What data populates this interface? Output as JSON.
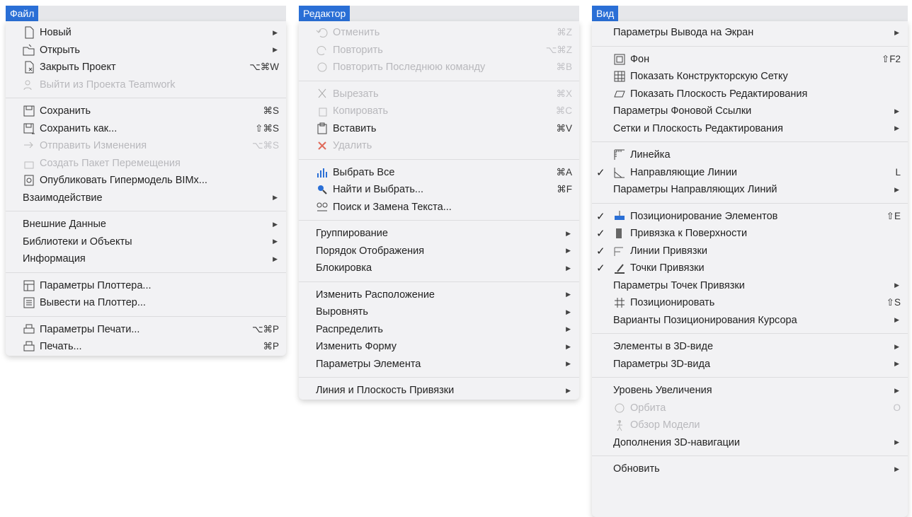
{
  "menus": [
    {
      "title": "Файл",
      "items": [
        {
          "label": "Новый",
          "icon": "new-file-icon",
          "submenu": true
        },
        {
          "label": "Открыть",
          "icon": "open-folder-icon",
          "submenu": true
        },
        {
          "label": "Закрыть Проект",
          "icon": "close-project-icon",
          "shortcut": "⌥⌘W"
        },
        {
          "label": "Выйти из Проекта Teamwork",
          "icon": "teamwork-icon",
          "disabled": true
        },
        {
          "sep": true
        },
        {
          "label": "Сохранить",
          "icon": "save-icon",
          "shortcut": "⌘S"
        },
        {
          "label": "Сохранить как...",
          "icon": "save-as-icon",
          "shortcut": "⇧⌘S"
        },
        {
          "label": "Отправить Изменения",
          "icon": "send-icon",
          "shortcut": "⌥⌘S",
          "disabled": true
        },
        {
          "label": "Создать Пакет Перемещения",
          "icon": "package-icon",
          "disabled": true
        },
        {
          "label": "Опубликовать Гипермодель BIMx...",
          "icon": "publish-icon"
        },
        {
          "label": "Взаимодействие",
          "submenu": true
        },
        {
          "sep": true
        },
        {
          "label": "Внешние Данные",
          "submenu": true
        },
        {
          "label": "Библиотеки и Объекты",
          "submenu": true
        },
        {
          "label": "Информация",
          "submenu": true
        },
        {
          "sep": true
        },
        {
          "label": "Параметры Плоттера...",
          "icon": "plotter-settings-icon"
        },
        {
          "label": "Вывести на Плоттер...",
          "icon": "plotter-icon"
        },
        {
          "sep": true
        },
        {
          "label": "Параметры Печати...",
          "icon": "print-settings-icon",
          "shortcut": "⌥⌘P"
        },
        {
          "label": "Печать...",
          "icon": "print-icon",
          "shortcut": "⌘P"
        }
      ]
    },
    {
      "title": "Редактор",
      "items": [
        {
          "label": "Отменить",
          "icon": "undo-icon",
          "shortcut": "⌘Z",
          "disabled": true
        },
        {
          "label": "Повторить",
          "icon": "redo-icon",
          "shortcut": "⌥⌘Z",
          "disabled": true
        },
        {
          "label": "Повторить Последнюю команду",
          "icon": "repeat-icon",
          "shortcut": "⌘B",
          "disabled": true
        },
        {
          "sep": true
        },
        {
          "label": "Вырезать",
          "icon": "cut-icon",
          "shortcut": "⌘X",
          "disabled": true
        },
        {
          "label": "Копировать",
          "icon": "copy-icon",
          "shortcut": "⌘C",
          "disabled": true
        },
        {
          "label": "Вставить",
          "icon": "paste-icon",
          "shortcut": "⌘V"
        },
        {
          "label": "Удалить",
          "icon": "delete-icon",
          "disabled": true
        },
        {
          "sep": true
        },
        {
          "label": "Выбрать Все",
          "icon": "select-all-icon",
          "shortcut": "⌘A"
        },
        {
          "label": "Найти и Выбрать...",
          "icon": "find-select-icon",
          "shortcut": "⌘F"
        },
        {
          "label": "Поиск и Замена Текста...",
          "icon": "find-replace-icon"
        },
        {
          "sep": true
        },
        {
          "label": "Группирование",
          "submenu": true
        },
        {
          "label": "Порядок Отображения",
          "submenu": true
        },
        {
          "label": "Блокировка",
          "submenu": true
        },
        {
          "sep": true
        },
        {
          "label": "Изменить Расположение",
          "submenu": true
        },
        {
          "label": "Выровнять",
          "submenu": true
        },
        {
          "label": "Распределить",
          "submenu": true
        },
        {
          "label": "Изменить Форму",
          "submenu": true
        },
        {
          "label": "Параметры Элемента",
          "submenu": true
        },
        {
          "sep": true
        },
        {
          "label": "Линия и Плоскость Привязки",
          "submenu": true
        }
      ]
    },
    {
      "title": "Вид",
      "items": [
        {
          "label": "Параметры Вывода на Экран",
          "submenu": true
        },
        {
          "sep": true
        },
        {
          "label": "Фон",
          "icon": "background-icon",
          "shortcut": "⇧F2"
        },
        {
          "label": "Показать Конструкторскую Сетку",
          "icon": "grid-icon"
        },
        {
          "label": "Показать Плоскость Редактирования",
          "icon": "edit-plane-icon"
        },
        {
          "label": "Параметры Фоновой Ссылки",
          "submenu": true
        },
        {
          "label": "Сетки и Плоскость Редактирования",
          "submenu": true
        },
        {
          "sep": true
        },
        {
          "label": "Линейка",
          "icon": "ruler-icon"
        },
        {
          "label": "Направляющие Линии",
          "icon": "guide-lines-icon",
          "checked": true,
          "shortcut": "L"
        },
        {
          "label": "Параметры Направляющих Линий",
          "submenu": true
        },
        {
          "sep": true
        },
        {
          "label": "Позиционирование Элементов",
          "icon": "positioning-icon",
          "checked": true,
          "shortcut": "⇧E"
        },
        {
          "label": "Привязка к Поверхности",
          "icon": "surface-snap-icon",
          "checked": true
        },
        {
          "label": "Линии Привязки",
          "icon": "snap-lines-icon",
          "checked": true
        },
        {
          "label": "Точки Привязки",
          "icon": "snap-points-icon",
          "checked": true
        },
        {
          "label": "Параметры Точек Привязки",
          "submenu": true
        },
        {
          "label": "Позиционировать",
          "icon": "position-icon",
          "shortcut": "⇧S"
        },
        {
          "label": "Варианты Позиционирования Курсора",
          "submenu": true
        },
        {
          "sep": true
        },
        {
          "label": "Элементы в 3D-виде",
          "submenu": true
        },
        {
          "label": "Параметры 3D-вида",
          "submenu": true
        },
        {
          "sep": true
        },
        {
          "label": "Уровень Увеличения",
          "submenu": true
        },
        {
          "label": "Орбита",
          "icon": "orbit-icon",
          "shortcut": "O",
          "disabled": true
        },
        {
          "label": "Обзор Модели",
          "icon": "explore-icon",
          "disabled": true
        },
        {
          "label": "Дополнения 3D-навигации",
          "submenu": true
        },
        {
          "sep": true
        },
        {
          "label": "Обновить",
          "submenu": true
        }
      ]
    }
  ],
  "submenu_arrow": "▶",
  "checkmark": "✓"
}
